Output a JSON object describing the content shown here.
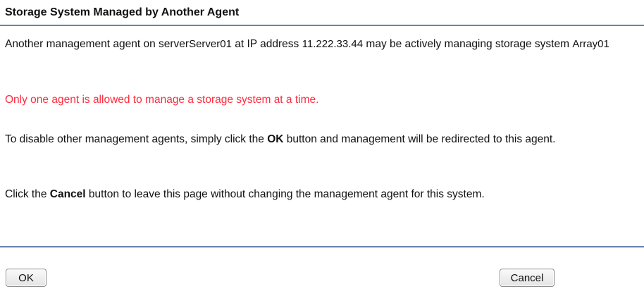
{
  "dialog": {
    "title": "Storage System Managed by Another Agent"
  },
  "message": {
    "p1_pre": "Another management agent on server",
    "server_name": "Server01",
    "p1_mid": " at IP address ",
    "ip_address": "11.222.33.44",
    "p1_mid2": " may be actively managing storage system ",
    "storage_system": "Array01",
    "warning": "Only one agent is allowed to manage a storage system at a time.",
    "p3_pre": "To disable other management agents, simply click the ",
    "p3_bold": "OK",
    "p3_post": " button and management will be redirected to this agent.",
    "p4_pre": "Click the ",
    "p4_bold": "Cancel",
    "p4_post": " button to leave this page without changing the management agent for this system."
  },
  "buttons": {
    "ok_label": "OK",
    "cancel_label": "Cancel"
  },
  "colors": {
    "warning_text": "#ff2a3c",
    "rule": "#6b7fb5"
  }
}
